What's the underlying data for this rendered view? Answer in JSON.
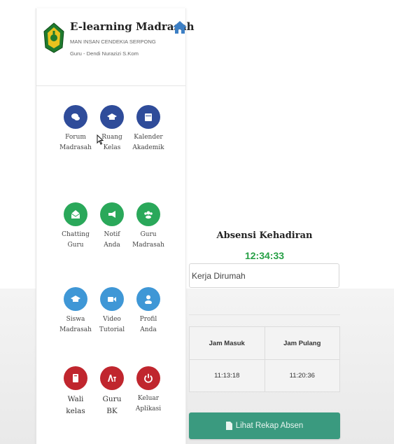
{
  "app": {
    "title": "E-learning Madrasah",
    "school": "MAN INSAN CENDEKIA SERPONG",
    "user": "Guru - Dendi Nurazizi S.Kom"
  },
  "menu": [
    {
      "label": "Forum\nMadrasah",
      "icon": "chat-bubbles-icon",
      "color": "#2f4c9a"
    },
    {
      "label": "Ruang\nKelas",
      "icon": "graduation-cap-icon",
      "color": "#2f4c9a"
    },
    {
      "label": "Kalender\nAkademik",
      "icon": "calendar-icon",
      "color": "#2f4c9a"
    },
    {
      "label": "Chatting\nGuru",
      "icon": "envelope-icon",
      "color": "#2aa85a"
    },
    {
      "label": "Notif\nAnda",
      "icon": "megaphone-icon",
      "color": "#2aa85a"
    },
    {
      "label": "Guru\nMadrasah",
      "icon": "users-icon",
      "color": "#2aa85a"
    },
    {
      "label": "Siswa\nMadrasah",
      "icon": "graduation-cap-icon",
      "color": "#3f97d6"
    },
    {
      "label": "Video\nTutorial",
      "icon": "video-camera-icon",
      "color": "#3f97d6"
    },
    {
      "label": "Profil\nAnda",
      "icon": "user-icon",
      "color": "#3f97d6"
    },
    {
      "label": "Wali\nkelas",
      "icon": "book-icon",
      "color": "#c0262e"
    },
    {
      "label": "Guru\nBK",
      "icon": "translate-icon",
      "color": "#c0262e"
    },
    {
      "label": "Keluar\nAplikasi",
      "icon": "power-icon",
      "color": "#c0262e"
    }
  ],
  "attendance": {
    "title": "Absensi Kehadiran",
    "clock": "12:34:33",
    "status": "Kerja Dirumah",
    "headers": [
      "Jam Masuk",
      "Jam Pulang"
    ],
    "values": [
      "11:13:18",
      "11:20:36"
    ],
    "button_label": "Lihat Rekap Absen"
  },
  "colors": {
    "accent_green": "#27a046",
    "button_teal": "#3a9a7f",
    "home_icon": "#3d7fc4"
  }
}
